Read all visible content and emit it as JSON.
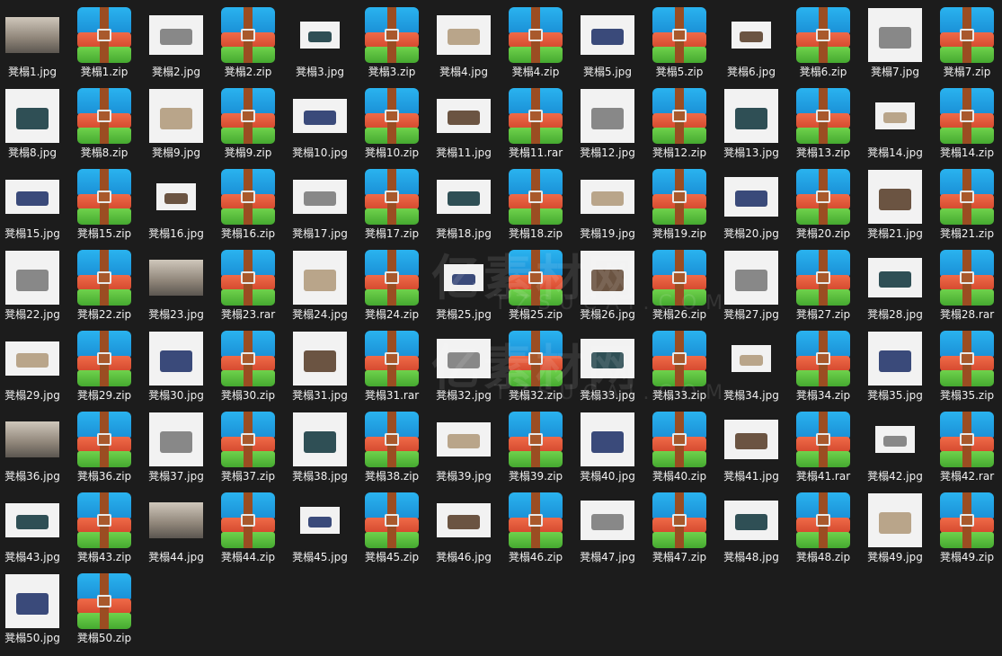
{
  "prefix": "凳榻",
  "rar_numbers": [
    11,
    23,
    28,
    31,
    41,
    42
  ],
  "count": 50,
  "items": [],
  "watermark": {
    "cn": "亿素材网",
    "en": "TZSUCAI.COM"
  },
  "colors": {
    "background": "#1c1c1c",
    "label": "#f0f0f0"
  }
}
